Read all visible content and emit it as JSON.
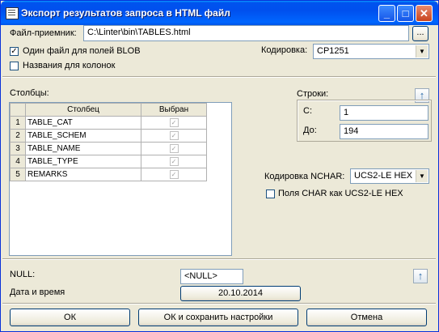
{
  "window": {
    "title": "Экспорт результатов запроса в HTML файл",
    "minimize": "_",
    "maximize": "□",
    "close": "✕"
  },
  "file": {
    "label": "Файл-приемник:",
    "value": "C:\\Linter\\bin\\TABLES.html",
    "browse_label": "..."
  },
  "options": {
    "one_file_blob": {
      "label": "Один файл для полей BLOB",
      "checked": true
    },
    "column_names": {
      "label": "Названия для колонок",
      "checked": false
    }
  },
  "encoding": {
    "label": "Кодировка:",
    "value": "CP1251"
  },
  "columns": {
    "label": "Столбцы:",
    "headers": {
      "num": "",
      "column": "Столбец",
      "selected": "Выбран"
    },
    "rows": [
      {
        "num": "1",
        "name": "TABLE_CAT",
        "selected": true
      },
      {
        "num": "2",
        "name": "TABLE_SCHEM",
        "selected": true
      },
      {
        "num": "3",
        "name": "TABLE_NAME",
        "selected": true
      },
      {
        "num": "4",
        "name": "TABLE_TYPE",
        "selected": true
      },
      {
        "num": "5",
        "name": "REMARKS",
        "selected": true
      }
    ]
  },
  "rows_range": {
    "label": "Строки:",
    "from_label": "С:",
    "from_value": "1",
    "to_label": "До:",
    "to_value": "194"
  },
  "nchar": {
    "label": "Кодировка NCHAR:",
    "value": "UCS2-LE HEX",
    "char_as_ucs_label": "Поля CHAR как UCS2-LE HEX",
    "char_as_ucs_checked": false
  },
  "null_field": {
    "label": "NULL:",
    "value": "<NULL>"
  },
  "datetime": {
    "label": "Дата и время",
    "value": "20.10.2014"
  },
  "buttons": {
    "ok": "ОК",
    "ok_save": "ОК и сохранить настройки",
    "cancel": "Отмена"
  },
  "icons": {
    "arrow_up": "↑",
    "dropdown": "▼",
    "checkmark": "✓"
  }
}
